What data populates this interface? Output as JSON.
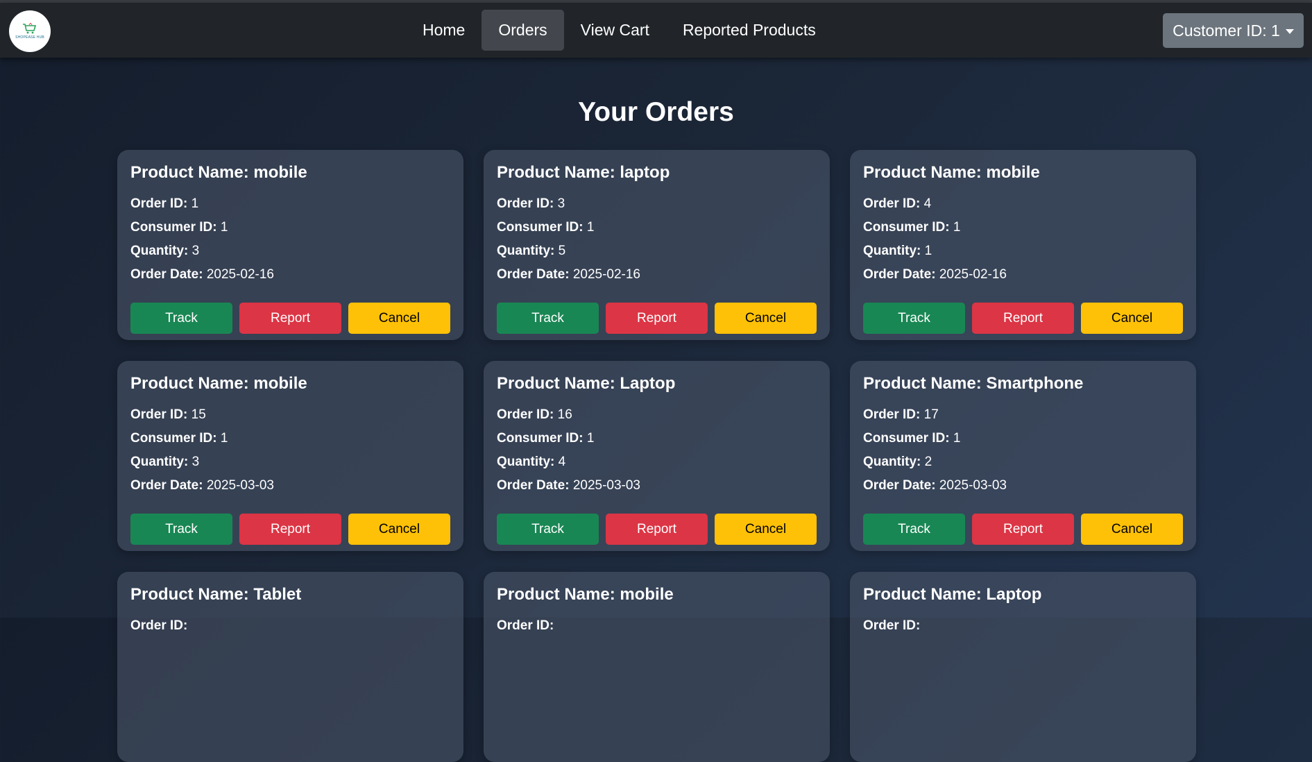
{
  "navbar": {
    "logo_text": "SHOPEASE HUB",
    "links": [
      {
        "label": "Home",
        "active": false
      },
      {
        "label": "Orders",
        "active": true
      },
      {
        "label": "View Cart",
        "active": false
      },
      {
        "label": "Reported Products",
        "active": false
      }
    ],
    "customer_label": "Customer ID: 1"
  },
  "page_title": "Your Orders",
  "labels": {
    "product": "Product Name:",
    "order_id": "Order ID:",
    "consumer_id": "Consumer ID:",
    "quantity": "Quantity:",
    "order_date": "Order Date:",
    "track": "Track",
    "report": "Report",
    "cancel": "Cancel"
  },
  "colors": {
    "track": "#198754",
    "report": "#dc3545",
    "cancel": "#ffc107",
    "navbar": "#212529",
    "customer_button": "#6c757d"
  },
  "orders": [
    {
      "product": "mobile",
      "order_id": "1",
      "consumer_id": "1",
      "quantity": "3",
      "order_date": "2025-02-16"
    },
    {
      "product": "laptop",
      "order_id": "3",
      "consumer_id": "1",
      "quantity": "5",
      "order_date": "2025-02-16"
    },
    {
      "product": "mobile",
      "order_id": "4",
      "consumer_id": "1",
      "quantity": "1",
      "order_date": "2025-02-16"
    },
    {
      "product": "mobile",
      "order_id": "15",
      "consumer_id": "1",
      "quantity": "3",
      "order_date": "2025-03-03"
    },
    {
      "product": "Laptop",
      "order_id": "16",
      "consumer_id": "1",
      "quantity": "4",
      "order_date": "2025-03-03"
    },
    {
      "product": "Smartphone",
      "order_id": "17",
      "consumer_id": "1",
      "quantity": "2",
      "order_date": "2025-03-03"
    },
    {
      "product": "Tablet"
    },
    {
      "product": "mobile"
    },
    {
      "product": "Laptop"
    }
  ]
}
